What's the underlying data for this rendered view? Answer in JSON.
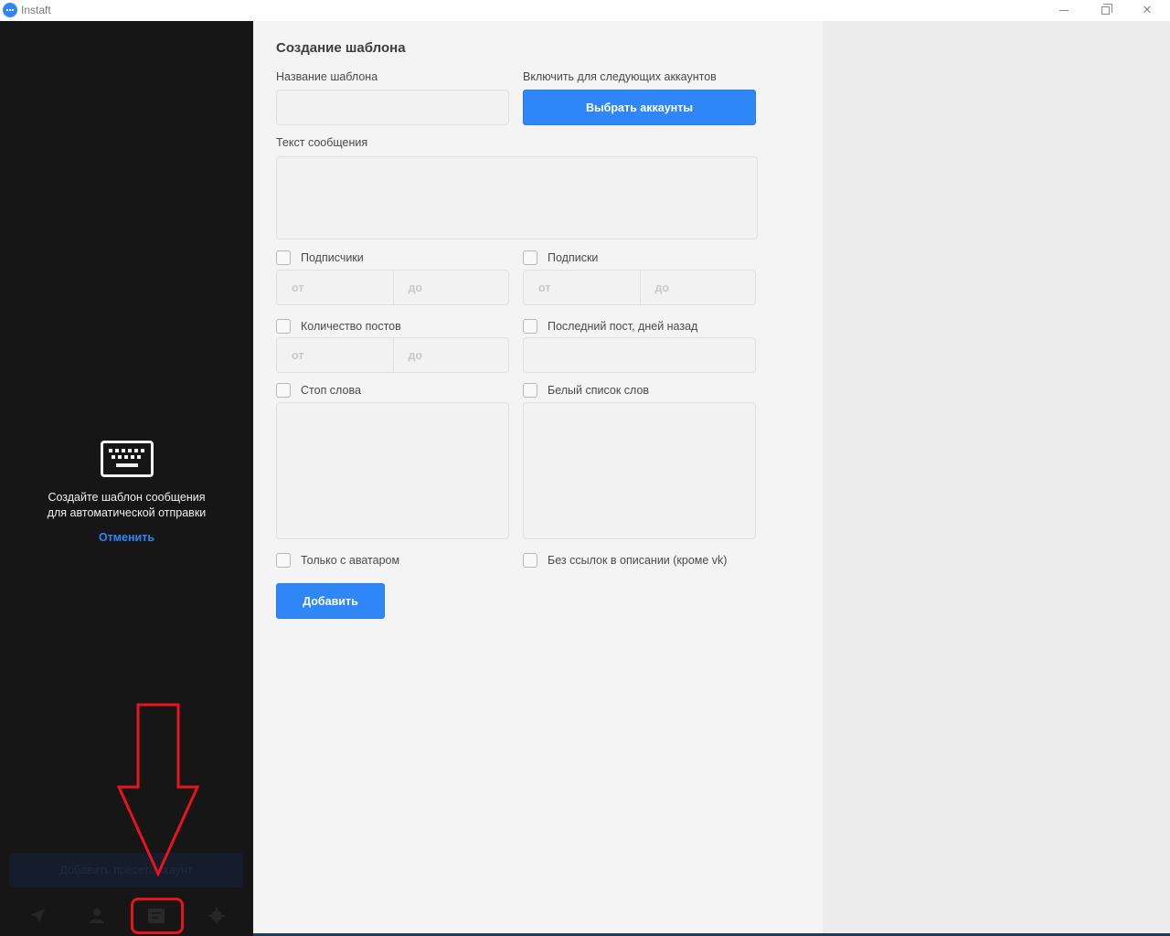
{
  "window": {
    "title": "Instaft",
    "controls": {
      "minimize": "minimize-icon",
      "maximize": "restore-icon",
      "close": "✕"
    }
  },
  "sidebar": {
    "empty_state": {
      "icon": "keyboard-icon",
      "line1": "Создайте шаблон сообщения",
      "line2": "для автоматической отправки",
      "cancel_link": "Отменить"
    },
    "add_account_button": "Добавить пресет/аккаунт",
    "bottom_nav": [
      {
        "icon": "send-icon"
      },
      {
        "icon": "user-icon"
      },
      {
        "icon": "templates-icon"
      },
      {
        "icon": "gear-icon"
      }
    ],
    "annotation_color": "#e8141c"
  },
  "form": {
    "title": "Создание шаблона",
    "template_name": {
      "label": "Название шаблона",
      "value": ""
    },
    "accounts": {
      "label": "Включить для следующих аккаунтов",
      "button": "Выбрать аккаунты"
    },
    "message_text": {
      "label": "Текст сообщения",
      "value": ""
    },
    "followers": {
      "label": "Подписчики",
      "checked": false,
      "from_placeholder": "от",
      "to_placeholder": "до"
    },
    "following": {
      "label": "Подписки",
      "checked": false,
      "from_placeholder": "от",
      "to_placeholder": "до"
    },
    "posts_count": {
      "label": "Количество постов",
      "checked": false,
      "from_placeholder": "от",
      "to_placeholder": "до"
    },
    "last_post": {
      "label": "Последний пост, дней назад",
      "checked": false,
      "value": ""
    },
    "stop_words": {
      "label": "Стоп слова",
      "checked": false,
      "value": ""
    },
    "whitelist": {
      "label": "Белый список слов",
      "checked": false,
      "value": ""
    },
    "only_avatar": {
      "label": "Только с аватаром",
      "checked": false
    },
    "no_links": {
      "label": "Без ссылок в описании (кроме vk)",
      "checked": false
    },
    "submit_button": "Добавить"
  },
  "colors": {
    "accent": "#2f86f6",
    "sidebar_bg": "#161616",
    "form_bg": "#f4f4f4"
  }
}
